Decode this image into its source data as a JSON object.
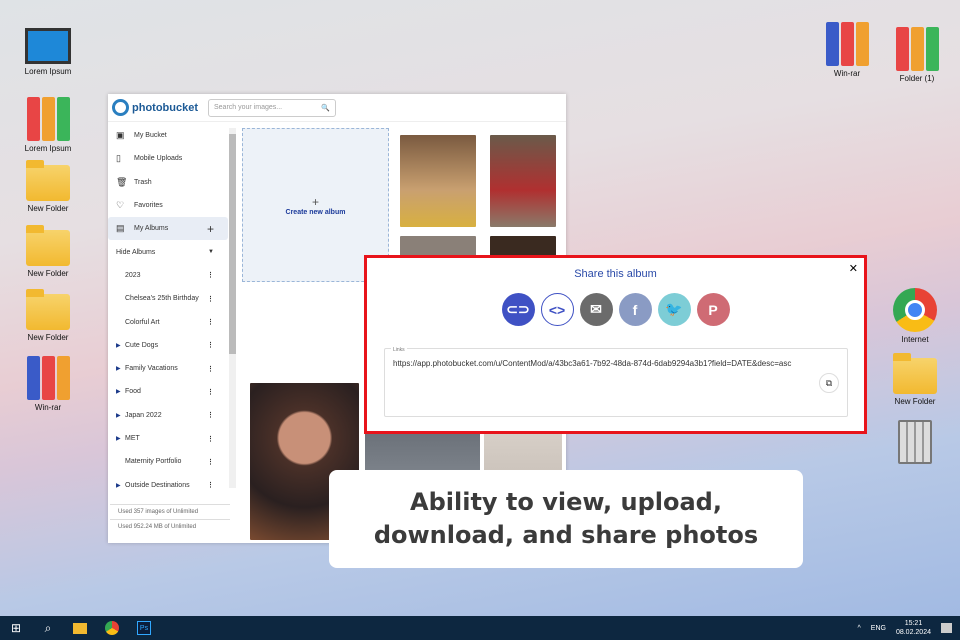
{
  "desktop": {
    "left": [
      {
        "label": "Lorem Ipsum",
        "icon": "computer-icon"
      },
      {
        "label": "Lorem Ipsum",
        "icon": "binders-icon"
      },
      {
        "label": "New Folder",
        "icon": "folder-icon"
      },
      {
        "label": "New Folder",
        "icon": "folder-icon"
      },
      {
        "label": "New Folder",
        "icon": "folder-icon"
      },
      {
        "label": "Win-rar",
        "icon": "winrar-icon"
      }
    ],
    "right": [
      {
        "label": "Win-rar"
      },
      {
        "label": "Folder (1)"
      },
      {
        "label": "Internet"
      },
      {
        "label": "New Folder"
      },
      {
        "label": "Recycle Bin"
      }
    ]
  },
  "app": {
    "logo": "photobucket",
    "search_placeholder": "Search your images...",
    "nav": [
      {
        "label": "My Bucket",
        "icon": "▣"
      },
      {
        "label": "Mobile Uploads",
        "icon": "▯"
      },
      {
        "label": "Trash",
        "icon": "🗑"
      },
      {
        "label": "Favorites",
        "icon": "♡"
      },
      {
        "label": "My Albums",
        "icon": "▤"
      }
    ],
    "hide_albums": "Hide Albums",
    "albums": [
      {
        "label": "2023",
        "expandable": false
      },
      {
        "label": "Chelsea's 25th Birthday",
        "expandable": false
      },
      {
        "label": "Colorful Art",
        "expandable": false
      },
      {
        "label": "Cute Dogs",
        "expandable": true
      },
      {
        "label": "Family Vacations",
        "expandable": true
      },
      {
        "label": "Food",
        "expandable": true
      },
      {
        "label": "Japan 2022",
        "expandable": true
      },
      {
        "label": "MET",
        "expandable": true
      },
      {
        "label": "Maternity Portfolio",
        "expandable": false
      },
      {
        "label": "Outside Destinations",
        "expandable": true
      }
    ],
    "usage_images": "Used 357 images of Unlimited",
    "usage_storage": "Used 952.24 MB of Unlimited",
    "create_album": "Create new album",
    "plus": "+"
  },
  "share": {
    "title": "Share this album",
    "close": "✕",
    "links_label": "Links",
    "url": "https://app.photobucket.com/u/ContentMod/a/43bc3a61-7b92-48da-874d-6dab9294a3b1?field=DATE&desc=asc",
    "buttons": [
      {
        "name": "link",
        "glyph": "⊂⊃",
        "color": "#3f51c4"
      },
      {
        "name": "embed",
        "glyph": "<>",
        "color": "#ffffff"
      },
      {
        "name": "email",
        "glyph": "✉",
        "color": "#6b6b6b"
      },
      {
        "name": "facebook",
        "glyph": "f",
        "color": "#8a9bc4"
      },
      {
        "name": "twitter",
        "glyph": "🐦",
        "color": "#7dcdd6"
      },
      {
        "name": "pinterest",
        "glyph": "P",
        "color": "#cf6b74"
      }
    ]
  },
  "caption": "Ability to view, upload, download, and share photos",
  "taskbar": {
    "lang": "ENG",
    "time": "15:21",
    "date": "08.02.2024"
  }
}
